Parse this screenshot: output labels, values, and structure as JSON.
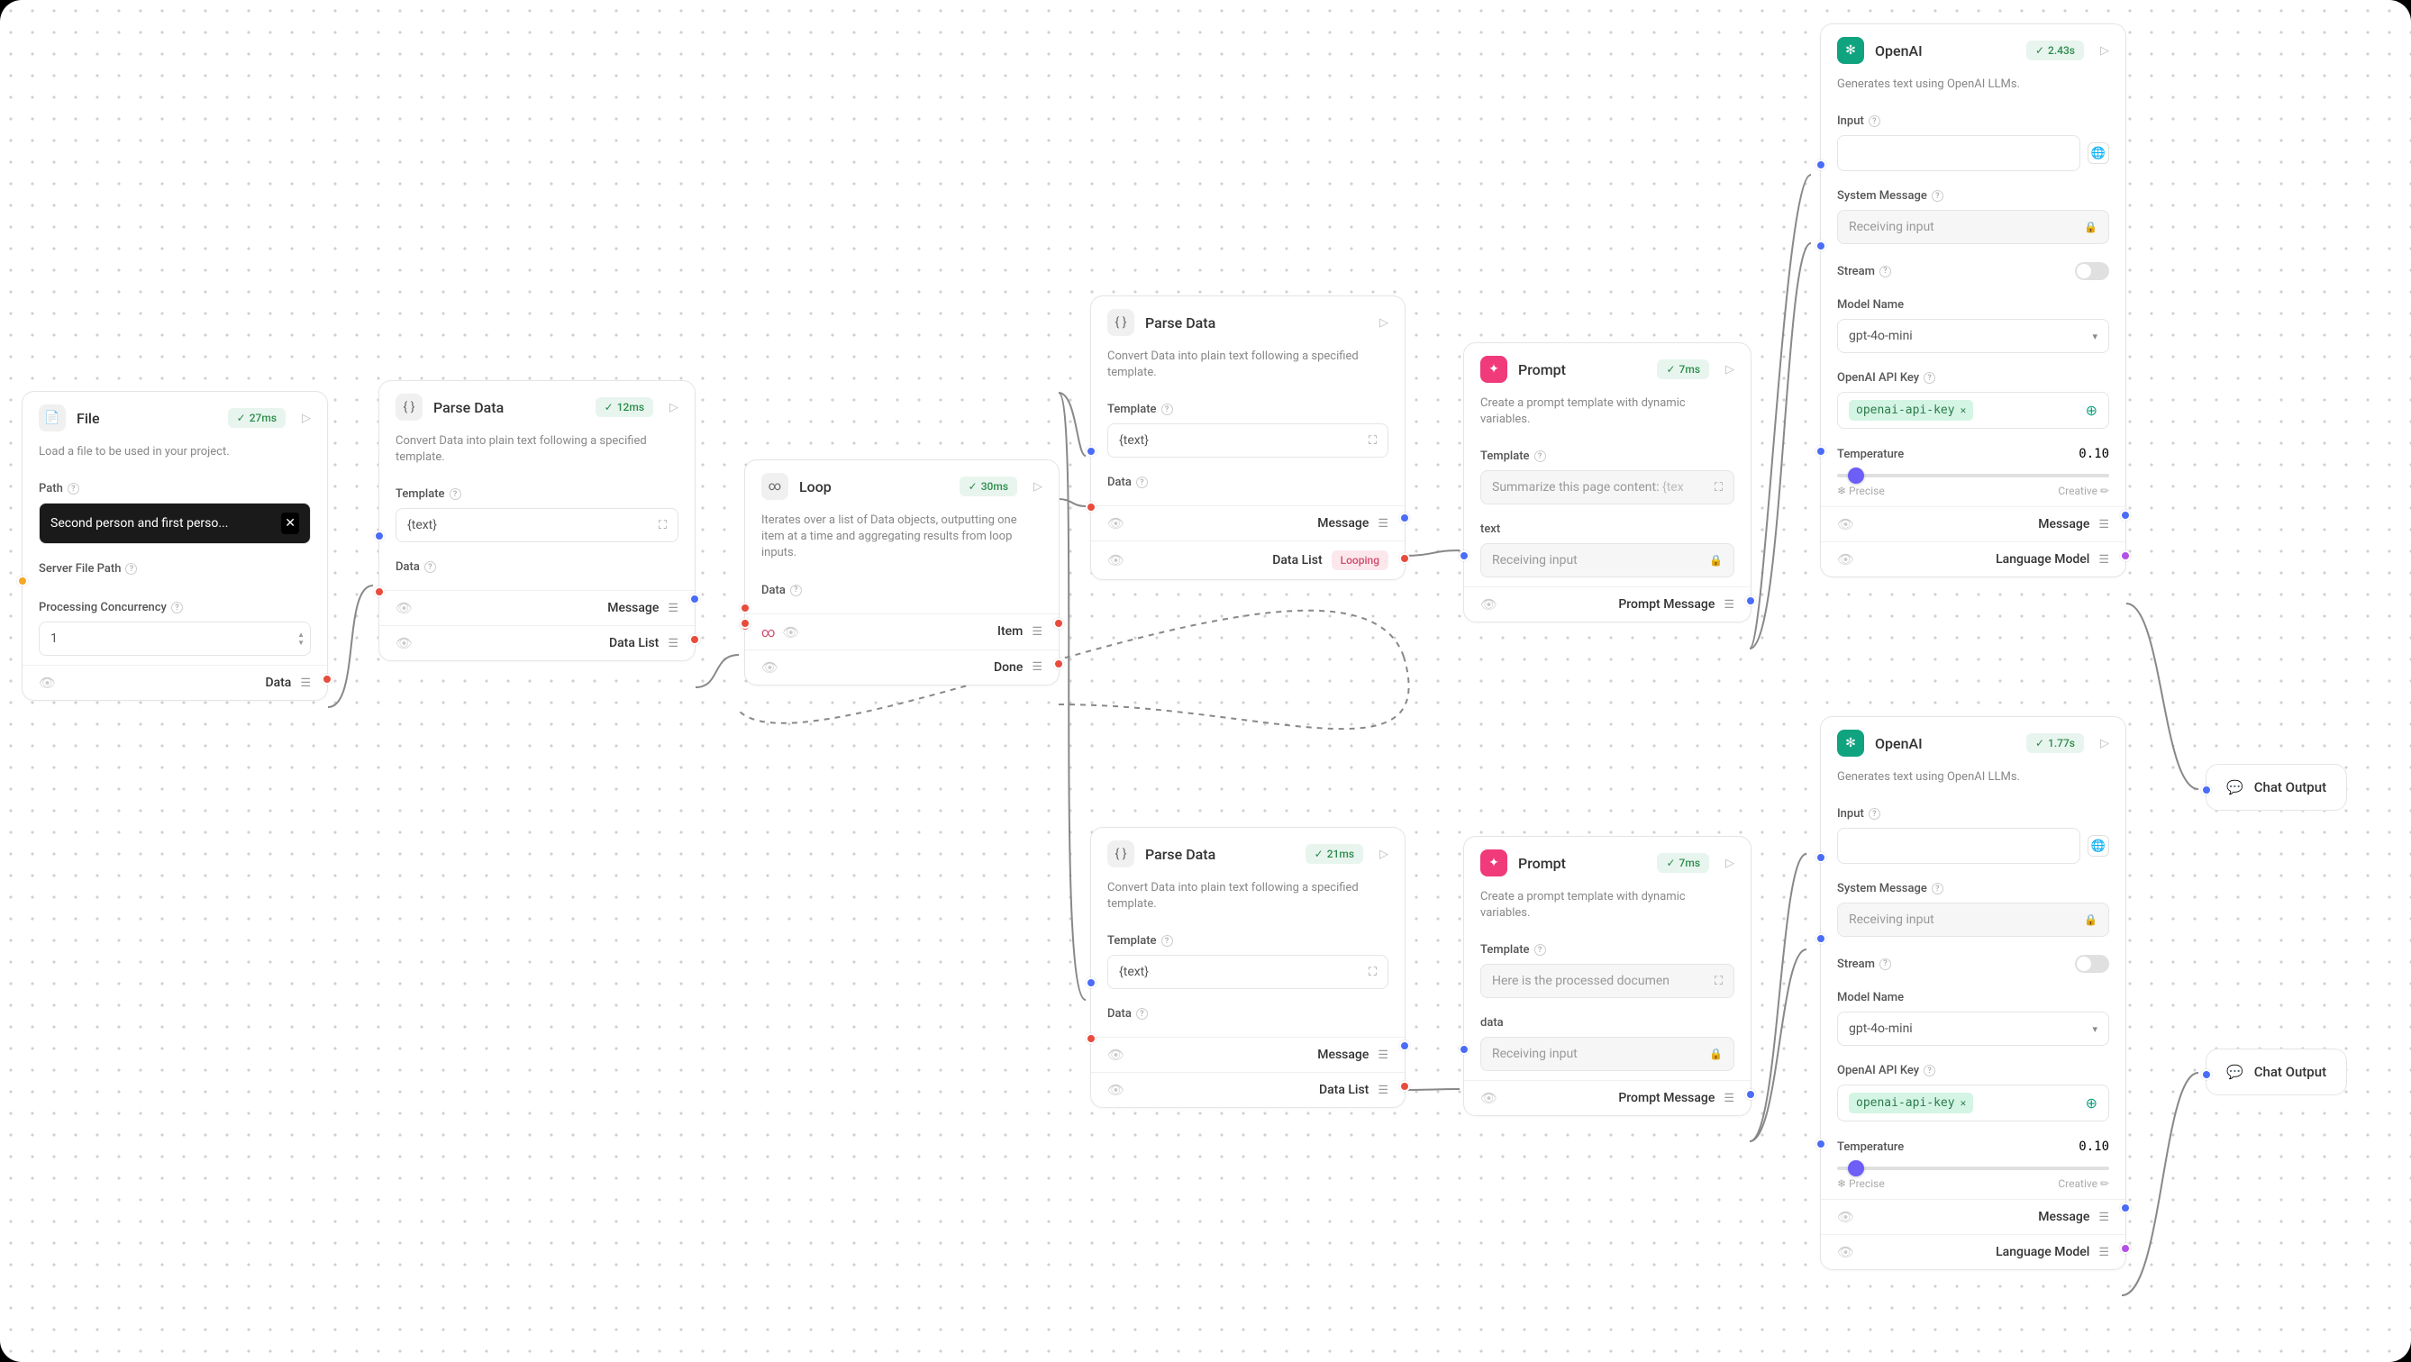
{
  "nodes": {
    "file": {
      "title": "File",
      "badge": "27ms",
      "desc": "Load a file to be used in your project.",
      "path_label": "Path",
      "path_value": "Second person and first perso...",
      "server_path_label": "Server File Path",
      "concurrency_label": "Processing Concurrency",
      "concurrency_value": "1",
      "out_data": "Data"
    },
    "parse1": {
      "title": "Parse Data",
      "badge": "12ms",
      "desc": "Convert Data into plain text following a specified template.",
      "template_label": "Template",
      "template_value": "{text}",
      "data_label": "Data",
      "out_message": "Message",
      "out_datalist": "Data List"
    },
    "loop": {
      "title": "Loop",
      "badge": "30ms",
      "desc": "Iterates over a list of Data objects, outputting one item at a time and aggregating results from loop inputs.",
      "data_label": "Data",
      "out_item": "Item",
      "out_done": "Done"
    },
    "parse2": {
      "title": "Parse Data",
      "desc": "Convert Data into plain text following a specified template.",
      "template_label": "Template",
      "template_value": "{text}",
      "data_label": "Data",
      "out_message": "Message",
      "out_datalist": "Data List",
      "looping": "Looping"
    },
    "parse3": {
      "title": "Parse Data",
      "badge": "21ms",
      "desc": "Convert Data into plain text following a specified template.",
      "template_label": "Template",
      "template_value": "{text}",
      "data_label": "Data",
      "out_message": "Message",
      "out_datalist": "Data List"
    },
    "prompt1": {
      "title": "Prompt",
      "badge": "7ms",
      "desc": "Create a prompt template with dynamic variables.",
      "template_label": "Template",
      "template_value": "Summarize this page content:",
      "template_hint": "{tex",
      "var_label": "text",
      "var_placeholder": "Receiving input",
      "out": "Prompt Message"
    },
    "prompt2": {
      "title": "Prompt",
      "badge": "7ms",
      "desc": "Create a prompt template with dynamic variables.",
      "template_label": "Template",
      "template_value": "Here is the processed documen",
      "var_label": "data",
      "var_placeholder": "Receiving input",
      "out": "Prompt Message"
    },
    "openai1": {
      "title": "OpenAI",
      "badge": "2.43s",
      "desc": "Generates text using OpenAI LLMs.",
      "input_label": "Input",
      "sysmsg_label": "System Message",
      "sysmsg_placeholder": "Receiving input",
      "stream_label": "Stream",
      "model_label": "Model Name",
      "model_value": "gpt-4o-mini",
      "apikey_label": "OpenAI API Key",
      "apikey_value": "openai-api-key",
      "temp_label": "Temperature",
      "temp_value": "0.10",
      "precise": "Precise",
      "creative": "Creative",
      "out_message": "Message",
      "out_lm": "Language Model"
    },
    "openai2": {
      "title": "OpenAI",
      "badge": "1.77s",
      "desc": "Generates text using OpenAI LLMs.",
      "input_label": "Input",
      "sysmsg_label": "System Message",
      "sysmsg_placeholder": "Receiving input",
      "stream_label": "Stream",
      "model_label": "Model Name",
      "model_value": "gpt-4o-mini",
      "apikey_label": "OpenAI API Key",
      "apikey_value": "openai-api-key",
      "temp_label": "Temperature",
      "temp_value": "0.10",
      "precise": "Precise",
      "creative": "Creative",
      "out_message": "Message",
      "out_lm": "Language Model"
    },
    "chatout1": {
      "label": "Chat Output"
    },
    "chatout2": {
      "label": "Chat Output"
    }
  }
}
